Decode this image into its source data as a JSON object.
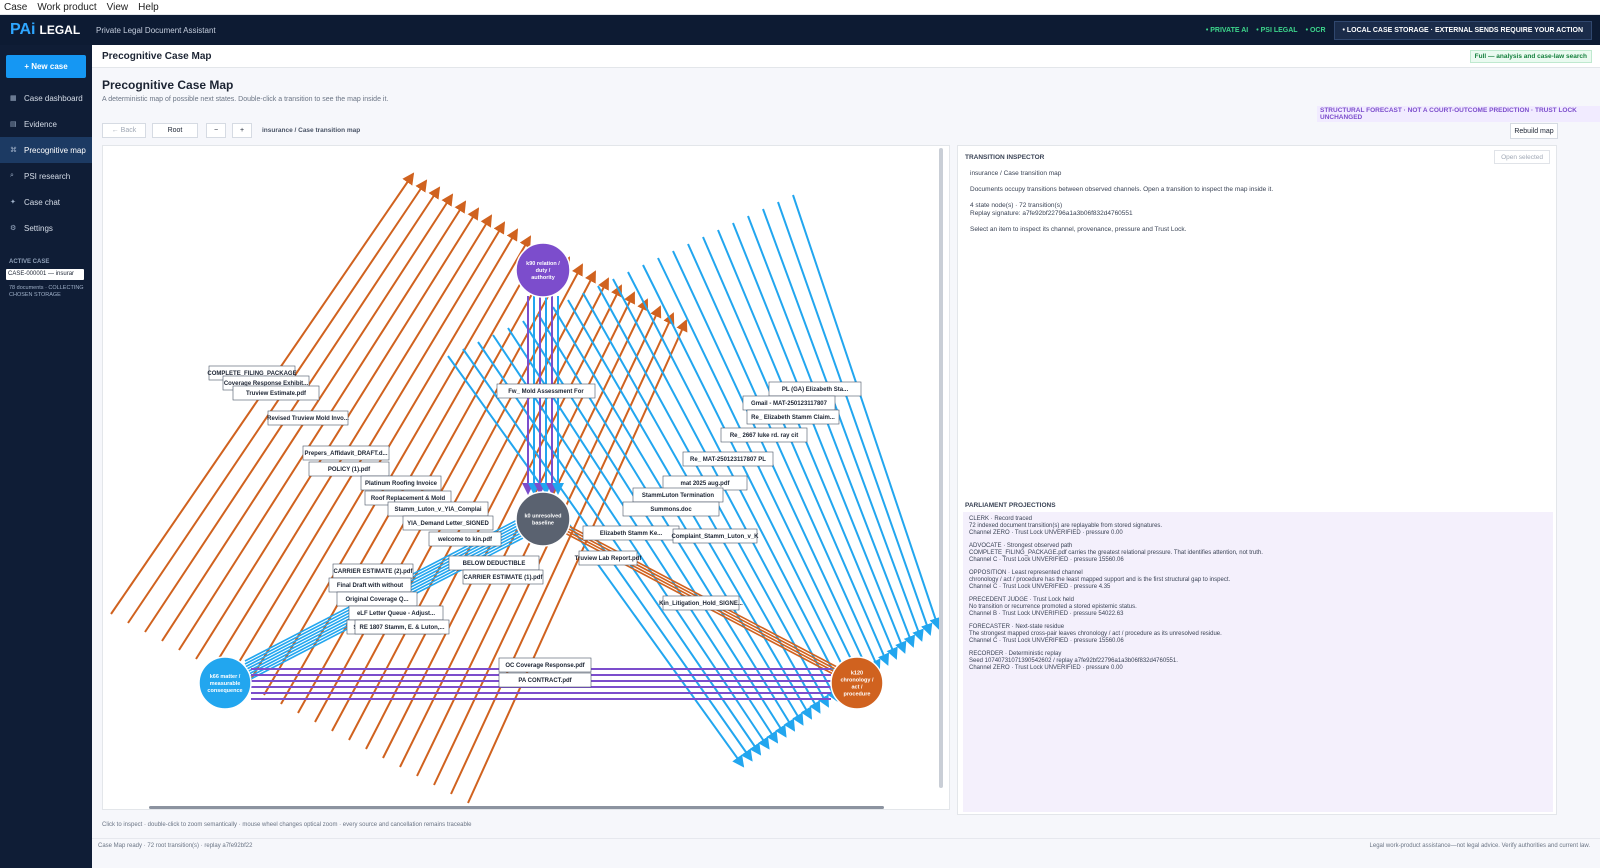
{
  "menu": [
    "Case",
    "Work product",
    "View",
    "Help"
  ],
  "brand": {
    "pai": "PAi",
    "legal": "LEGAL",
    "subtitle": "Private Legal Document Assistant"
  },
  "top_pills": [
    "• PRIVATE AI",
    "• PSI LEGAL",
    "• OCR"
  ],
  "storage_badge": "• LOCAL CASE STORAGE · EXTERNAL SENDS REQUIRE YOUR ACTION",
  "sidebar": {
    "new_case": "+  New case",
    "items": [
      {
        "icon": "▦",
        "label": "Case dashboard"
      },
      {
        "icon": "▤",
        "label": "Evidence"
      },
      {
        "icon": "⌘",
        "label": "Precognitive map"
      },
      {
        "icon": "⌕",
        "label": "PSI research"
      },
      {
        "icon": "✦",
        "label": "Case chat"
      },
      {
        "icon": "⚙",
        "label": "Settings"
      }
    ],
    "active_case_label": "ACTIVE CASE",
    "active_case_value": "CASE-000001 — insurar",
    "active_case_info": "78 documents · COLLECTING CHOSEN STORAGE"
  },
  "header": {
    "title": "Precognitive Case Map",
    "mode": "Full — analysis and case-law search"
  },
  "page": {
    "title": "Precognitive Case Map",
    "description": "A deterministic map of possible next states. Double-click a transition to see the map inside it.",
    "forecast_badge": "STRUCTURAL FORECAST · NOT A COURT-OUTCOME PREDICTION · TRUST LOCK UNCHANGED"
  },
  "toolbar": {
    "back": "← Back",
    "root": "Root",
    "zoom_out": "−",
    "zoom_in": "+",
    "breadcrumb": "insurance / Case transition map",
    "rebuild": "Rebuild map"
  },
  "map": {
    "nodes": [
      {
        "id": "k90",
        "label": "k90 relation / duty / authority",
        "color": "#7c4dcc"
      },
      {
        "id": "k0",
        "label": "k0 unresolved baseline",
        "color": "#5a6270"
      },
      {
        "id": "k66",
        "label": "k66 matter / measurable consequence",
        "color": "#22a6ef"
      },
      {
        "id": "k120",
        "label": "k120 chronology / act / procedure",
        "color": "#d0621f"
      }
    ],
    "documents": [
      "COMPLETE_FILING_PACKAGE",
      "Coverage Response Exhibit...",
      "Truview Estimate.pdf",
      "Revised Truview Mold Invo...",
      "Prepers_Affidavit_DRAFT.d...",
      "POLICY (1).pdf",
      "Platinum Roofing Invoice",
      "Roof Replacement & Mold",
      "Stamm_Luton_v_YIA_Complai",
      "YIA_Demand Letter_SIGNED",
      "welcome to kin.pdf",
      "BELOW DEDUCTIBLE",
      "CARRIER ESTIMATE (1).pdf",
      "CARRIER ESTIMATE (2).pdf",
      "Final Draft with without",
      "Original Coverage Q...",
      "eLF Letter Queue - Adjust...",
      "Stamm Communications.pdf",
      "RE 1807 Stamm, E. & Luton,...",
      "Fw_ Mold Assessment For",
      "PL (GA) Elizabeth Sta...",
      "Gmail - MAT-250123117807",
      "Re_ Elizabeth Stamm Claim...",
      "Re_ 2667 luke rd. ray cit",
      "Re_ MAT-250123117807 PL",
      "mat 2025 aug.pdf",
      "StammLuton Termination",
      "Summons.doc",
      "Truview Lab Report.pdf",
      "Elizabeth Stamm Ke...",
      "Complaint_Stamm_Luton_v_K",
      "Kin_Litigation_Hold_SIGNE...",
      "OC Coverage Response.pdf",
      "PA CONTRACT.pdf"
    ]
  },
  "map_help": "Click to inspect · double-click to zoom semantically · mouse wheel changes optical zoom · every source and cancellation remains traceable",
  "inspector": {
    "title": "TRANSITION INSPECTOR",
    "open_selected": "Open selected",
    "lines": [
      "insurance / Case transition map",
      "",
      "Documents occupy transitions between observed channels. Open a transition to inspect the map inside it.",
      "",
      "4 state node(s) · 72 transition(s)",
      "Replay signature: a7fe92bf22796a1a3b06f832d4760551",
      "",
      "Select an item to inspect its channel, provenance, pressure and Trust Lock."
    ]
  },
  "parliament": {
    "title": "PARLIAMENT PROJECTIONS",
    "lines": [
      "CLERK · Record traced",
      "72 indexed document transition(s) are replayable from stored signatures.",
      "Channel ZERO · Trust Lock UNVERIFIED · pressure 0.00",
      "",
      "ADVOCATE · Strongest observed path",
      "COMPLETE_FILING_PACKAGE.pdf carries the greatest relational pressure. That identifies attention, not truth.",
      "Channel C · Trust Lock UNVERIFIED · pressure 15560.06",
      "",
      "OPPOSITION · Least represented channel",
      "chronology / act / procedure has the least mapped support and is the first structural gap to inspect.",
      "Channel C · Trust Lock UNVERIFIED · pressure 4.35",
      "",
      "PRECEDENT JUDGE · Trust Lock held",
      "No transition or recurrence promoted a stored epistemic status.",
      "Channel B · Trust Lock UNVERIFIED · pressure 54022.63",
      "",
      "FORECASTER · Next-state residue",
      "The strongest mapped cross-pair leaves chronology / act / procedure as its unresolved residue.",
      "Channel C · Trust Lock UNVERIFIED · pressure 15560.06",
      "",
      "RECORDER · Deterministic replay",
      "Seed 10740731071390542602 / replay a7fe92bf22796a1a3b06f832d4760551.",
      "Channel ZERO · Trust Lock UNVERIFIED · pressure 0.00"
    ]
  },
  "statusbar": {
    "left": "Case Map ready · 72 root transition(s) · replay a7fe92bf22",
    "right": "Legal work-product assistance—not legal advice. Verify authorities and current law."
  },
  "colors": {
    "orange": "#d0621f",
    "blue": "#22a6ef",
    "purple": "#7c4dcc",
    "gray": "#5a6270",
    "navy": "#0d1b33"
  }
}
